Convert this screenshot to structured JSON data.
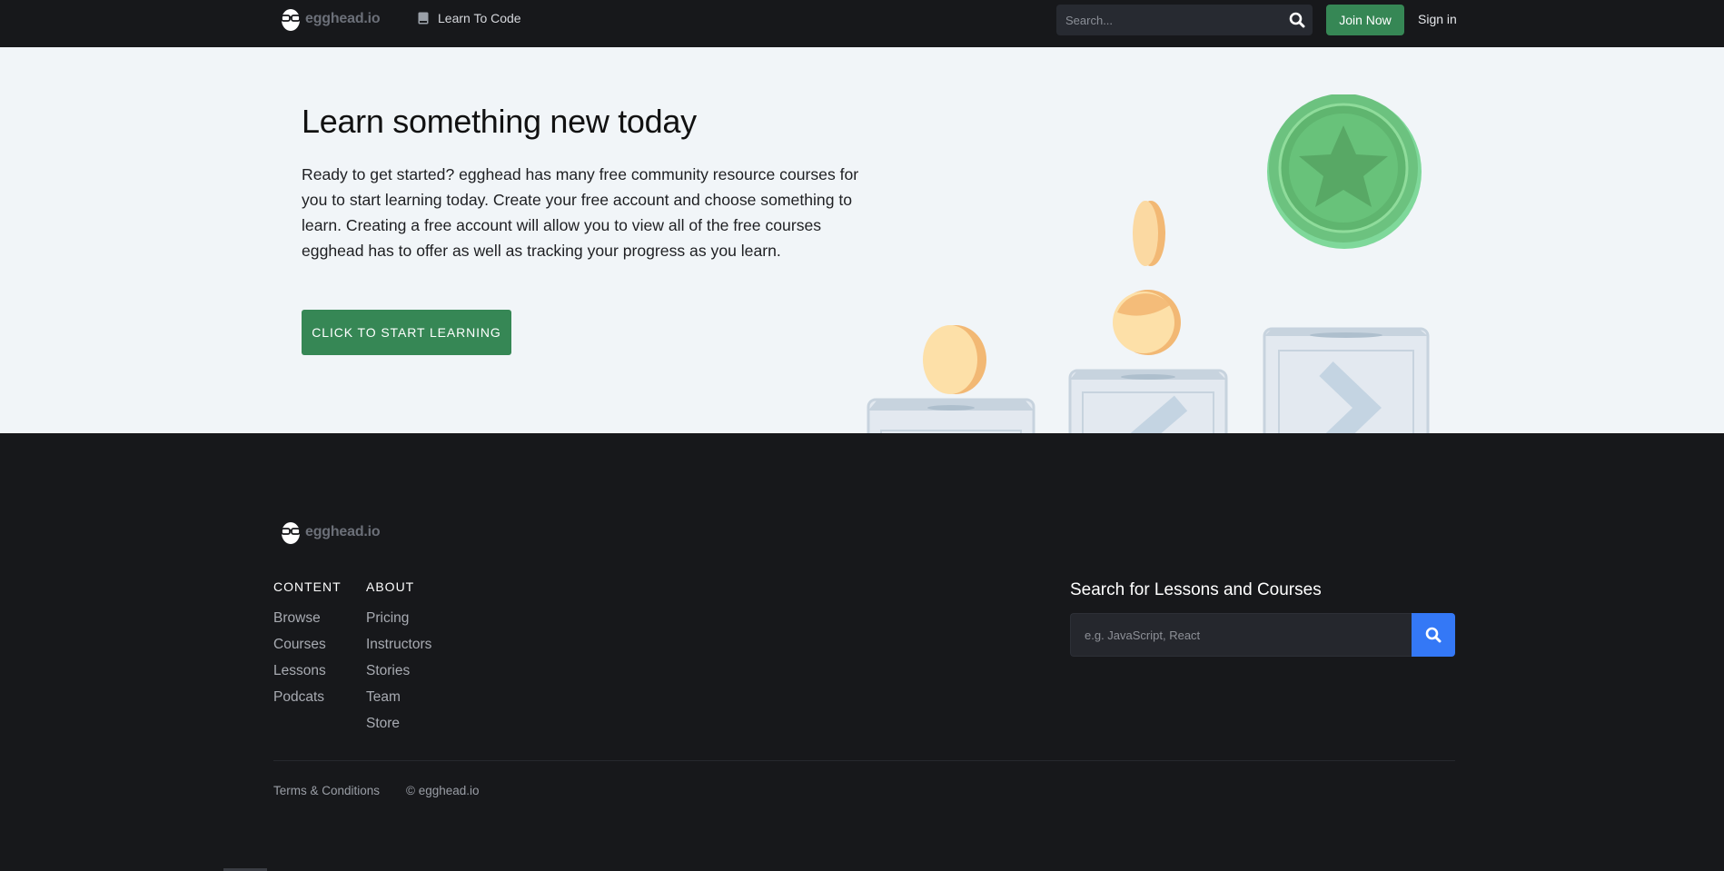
{
  "nav": {
    "logo_text": "egghead.io",
    "learn_label": "Learn To Code",
    "search_placeholder": "Search...",
    "join_label": "Join Now",
    "signin_label": "Sign in"
  },
  "hero": {
    "title": "Learn something new today",
    "body": "Ready to get started? egghead has many free community resource courses for you to start learning today. Create your free account and choose something to learn. Creating a free account will allow you to view all of the free courses egghead has to offer as well as tracking your progress as you learn.",
    "cta_label": "CLICK TO START LEARNING"
  },
  "footer": {
    "logo_text": "egghead.io",
    "content": {
      "title": "CONTENT",
      "links": [
        "Browse",
        "Courses",
        "Lessons",
        "Podcats"
      ]
    },
    "about": {
      "title": "ABOUT",
      "links": [
        "Pricing",
        "Instructors",
        "Stories",
        "Team",
        "Store"
      ]
    },
    "search": {
      "title": "Search for Lessons and Courses",
      "placeholder": "e.g. JavaScript, React"
    },
    "terms": "Terms & Conditions",
    "copyright": "© egghead.io"
  },
  "colors": {
    "brand_green": "#368755",
    "search_blue": "#3478f6",
    "dark_bg": "#17181b",
    "hero_bg": "#f1f5f8"
  },
  "icons": [
    "egghead-logo-icon",
    "book-icon",
    "search-icon",
    "star-coin-icon"
  ]
}
